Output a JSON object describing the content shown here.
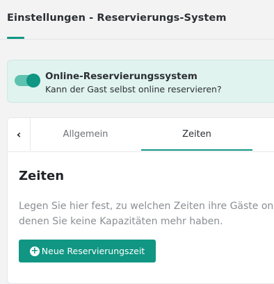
{
  "header": {
    "title": "Einstellungen - Reservierungs-System"
  },
  "online_toggle": {
    "enabled": true,
    "title": "Online-Reservierungssystem",
    "subtitle": "Kann der Gast selbst online reservieren?"
  },
  "tabs": {
    "back_icon": "chevron-left-icon",
    "items": [
      {
        "label": "Allgemein",
        "active": false
      },
      {
        "label": "Zeiten",
        "active": true
      }
    ]
  },
  "section": {
    "title": "Zeiten",
    "description_line1": "Legen Sie hier fest, zu welchen Zeiten ihre Gäste online reservieren können, und an welchen Tagen Sie",
    "description_line2": "denen Sie keine Kapazitäten mehr haben.",
    "add_button_label": "Neue Reservierungszeit",
    "add_button_icon": "plus-circle-icon"
  },
  "colors": {
    "accent": "#109683",
    "toggle_card_bg": "#e0f3ef",
    "page_bg": "#f3f3f4"
  }
}
